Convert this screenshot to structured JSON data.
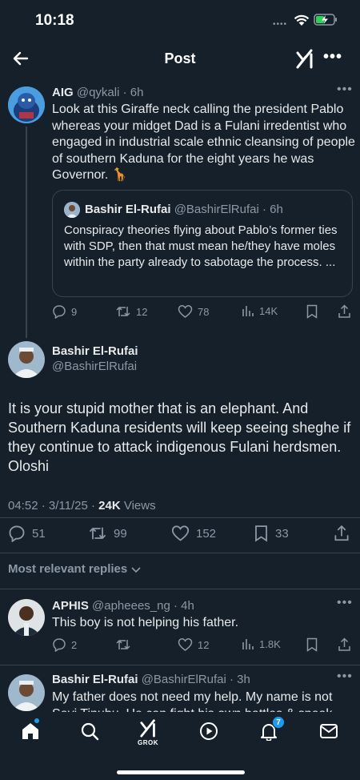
{
  "status_bar": {
    "time": "10:18"
  },
  "header": {
    "title": "Post"
  },
  "post1": {
    "name": "AIG",
    "handle": "@qykali",
    "time": "· 6h",
    "text": "Look at this Giraffe neck calling the president Pablo whereas your midget Dad is a Fulani irredentist who engaged in industrial scale ethnic cleansing of people of southern Kaduna for the eight years he was Governor. 🦒",
    "quote": {
      "name": "Bashir El-Rufai",
      "handle": "@BashirElRufai",
      "time": "· 6h",
      "text": "Conspiracy theories flying about Pablo’s former ties with SDP, then that must mean he/they have moles within the party already to sabotage the process. ..."
    },
    "stats": {
      "replies": "9",
      "reposts": "12",
      "likes": "78",
      "views": "14K"
    }
  },
  "main_post": {
    "name": "Bashir El-Rufai",
    "handle": "@BashirElRufai",
    "text": "It is your stupid mother that is an elephant. And Southern Kaduna residents will keep seeing sheghe if they continue to attack indigenous Fulani herdsmen. Oloshi",
    "timestamp": "04:52 · 3/11/25 · ",
    "views_count": "24K",
    "views_label": " Views",
    "stats": {
      "replies": "51",
      "reposts": "99",
      "likes": "152",
      "bookmarks": "33"
    }
  },
  "replies_filter": {
    "label": "Most relevant replies"
  },
  "reply1": {
    "name": "APHIS",
    "handle": "@apheees_ng",
    "time": "· 4h",
    "text": "This boy is not helping his father.",
    "stats": {
      "replies": "2",
      "likes": "12",
      "views": "1.8K"
    }
  },
  "reply2": {
    "name": "Bashir El-Rufai",
    "handle": "@BashirElRufai",
    "time": "· 3h",
    "text": "My father does not need my help. My name is not Seyi Tinubu. He can fight his own battles & speak"
  },
  "bottom_nav": {
    "grok_label": "GROK",
    "notifications_badge": "7"
  },
  "colors": {
    "background": "#15202b",
    "accent": "#1d9bf0",
    "muted": "#8b98a5"
  }
}
